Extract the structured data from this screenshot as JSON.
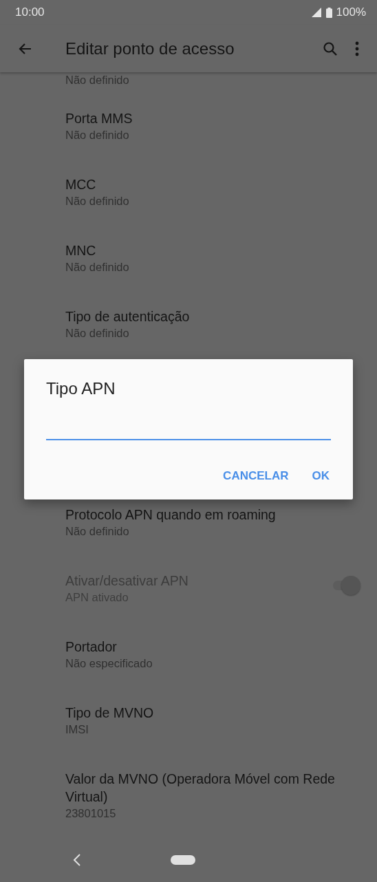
{
  "status_bar": {
    "time": "10:00",
    "battery": "100%"
  },
  "app_bar": {
    "title": "Editar ponto de acesso"
  },
  "list": {
    "items_above": [
      {
        "kind": "text",
        "subtitle": "Não definido",
        "disabled": false
      },
      {
        "kind": "text",
        "title": "Porta MMS",
        "subtitle": "Não definido",
        "disabled": false
      },
      {
        "kind": "text",
        "title": "MCC",
        "subtitle": "Não definido",
        "disabled": false
      },
      {
        "kind": "text",
        "title": "MNC",
        "subtitle": "Não definido",
        "disabled": false
      },
      {
        "kind": "text",
        "title": "Tipo de autenticação",
        "subtitle": "Não definido",
        "disabled": false
      }
    ],
    "items_below": [
      {
        "kind": "text",
        "title": "Protocolo APN quando em roaming",
        "subtitle": "Não definido",
        "disabled": false
      },
      {
        "kind": "switch",
        "title": "Ativar/desativar APN",
        "subtitle": "APN ativado",
        "disabled": true,
        "on": true
      },
      {
        "kind": "text",
        "title": "Portador",
        "subtitle": "Não especificado",
        "disabled": false
      },
      {
        "kind": "text",
        "title": "Tipo de MVNO",
        "subtitle": "IMSI",
        "disabled": false
      },
      {
        "kind": "text",
        "title": "Valor da MVNO (Operadora Móvel com Rede Virtual)",
        "subtitle": "23801015",
        "disabled": false
      }
    ]
  },
  "dialog": {
    "title": "Tipo APN",
    "buttons": [
      "CANCELAR",
      "OK"
    ]
  }
}
